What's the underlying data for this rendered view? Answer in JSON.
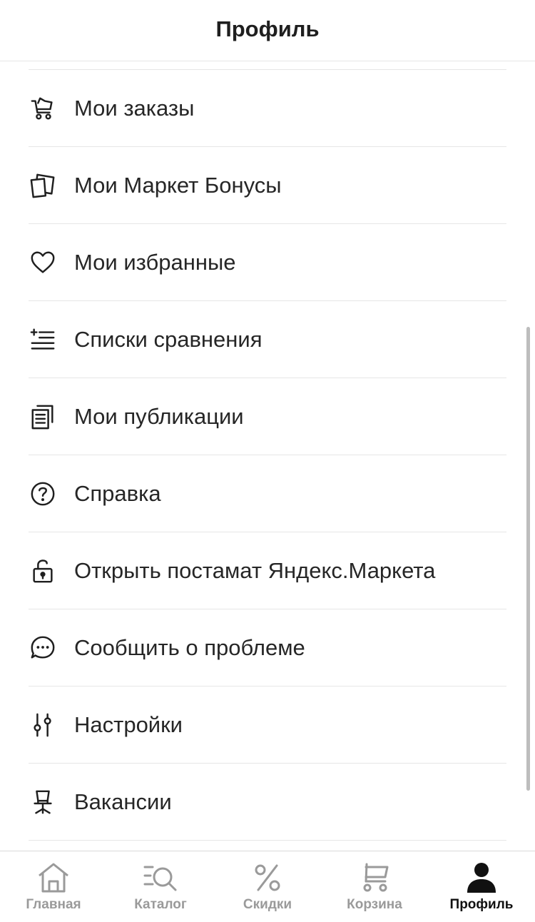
{
  "header": {
    "title": "Профиль"
  },
  "menu": {
    "items": [
      {
        "label": "Мои заказы",
        "icon": "cart-icon"
      },
      {
        "label": "Мои Маркет Бонусы",
        "icon": "bonus-cards-icon"
      },
      {
        "label": "Мои избранные",
        "icon": "heart-icon"
      },
      {
        "label": "Списки сравнения",
        "icon": "compare-list-icon"
      },
      {
        "label": "Мои публикации",
        "icon": "publications-icon"
      },
      {
        "label": "Справка",
        "icon": "help-icon"
      },
      {
        "label": "Открыть постамат Яндекс.Маркета",
        "icon": "unlock-icon"
      },
      {
        "label": "Сообщить о проблеме",
        "icon": "chat-icon"
      },
      {
        "label": "Настройки",
        "icon": "settings-sliders-icon"
      },
      {
        "label": "Вакансии",
        "icon": "office-chair-icon"
      }
    ]
  },
  "tabbar": {
    "tabs": [
      {
        "label": "Главная",
        "icon": "home-icon",
        "active": false
      },
      {
        "label": "Каталог",
        "icon": "catalog-search-icon",
        "active": false
      },
      {
        "label": "Скидки",
        "icon": "percent-icon",
        "active": false
      },
      {
        "label": "Корзина",
        "icon": "cart-icon",
        "active": false
      },
      {
        "label": "Профиль",
        "icon": "profile-icon",
        "active": true
      }
    ]
  },
  "colors": {
    "text": "#262626",
    "divider": "#e6e6e6",
    "tab_inactive": "#9a9a9a",
    "tab_active": "#111111"
  }
}
